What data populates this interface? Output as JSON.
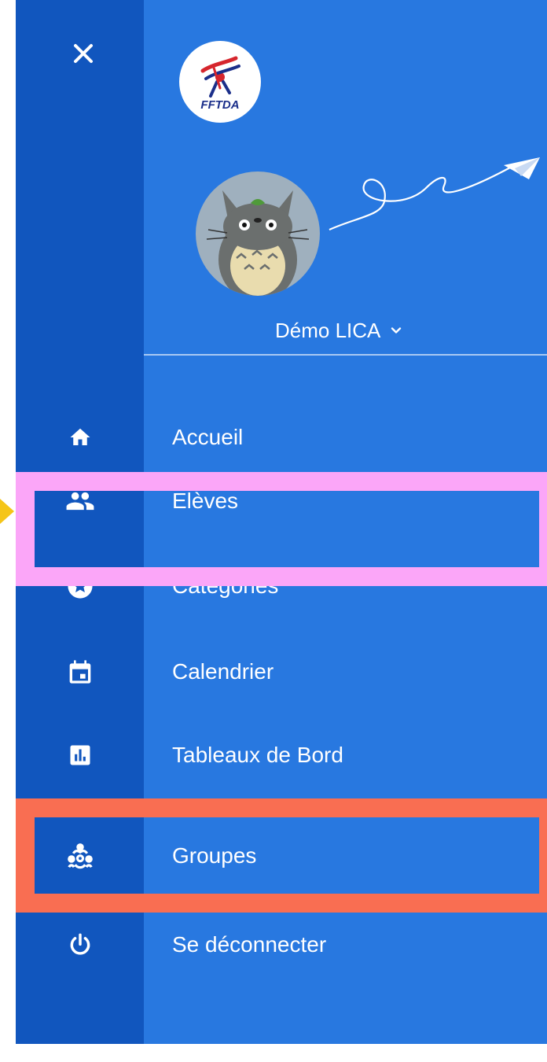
{
  "header": {
    "close_icon": "close-icon",
    "logo_text": "FFTDA",
    "account_name": "Démo LICA",
    "dropdown_icon": "chevron-down-icon"
  },
  "nav": {
    "items": [
      {
        "label": "Accueil",
        "icon": "home-icon"
      },
      {
        "label": "Elèves",
        "icon": "people-icon"
      },
      {
        "label": "Catégories",
        "icon": "star-circle-icon"
      },
      {
        "label": "Calendrier",
        "icon": "calendar-icon"
      },
      {
        "label": "Tableaux de Bord",
        "icon": "bar-chart-icon"
      },
      {
        "label": "Groupes",
        "icon": "group-icon"
      },
      {
        "label": "Se déconnecter",
        "icon": "power-icon"
      }
    ]
  },
  "colors": {
    "panel": "#2878e0",
    "rail": "#1156be",
    "highlight_pink": "#fba6f8",
    "highlight_orange": "#f96e52",
    "pointer": "#f5c518",
    "text": "#ffffff"
  }
}
